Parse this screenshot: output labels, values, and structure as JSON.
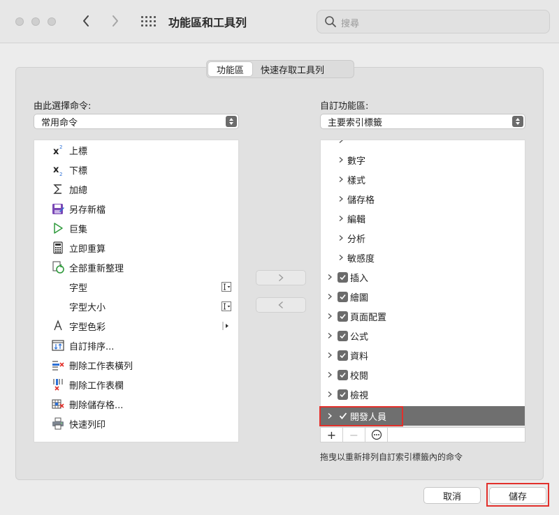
{
  "window": {
    "title": "功能區和工具列",
    "search_placeholder": "搜尋"
  },
  "tabs": [
    {
      "label": "功能區",
      "active": true
    },
    {
      "label": "快速存取工具列",
      "active": false
    }
  ],
  "left": {
    "label": "由此選擇命令:",
    "dropdown_value": "常用命令",
    "commands": [
      {
        "label": "上標",
        "icon": "superscript-icon"
      },
      {
        "label": "下標",
        "icon": "subscript-icon"
      },
      {
        "label": "加總",
        "icon": "sum-icon"
      },
      {
        "label": "另存新檔",
        "icon": "save-as-icon"
      },
      {
        "label": "巨集",
        "icon": "macro-play-icon"
      },
      {
        "label": "立即重算",
        "icon": "calculator-icon"
      },
      {
        "label": "全部重新整理",
        "icon": "refresh-all-icon"
      },
      {
        "label": "字型",
        "icon": "",
        "side": "combo-icon"
      },
      {
        "label": "字型大小",
        "icon": "",
        "side": "combo-icon"
      },
      {
        "label": "字型色彩",
        "icon": "font-color-icon",
        "side": "submenu-arrow-icon"
      },
      {
        "label": "自訂排序...",
        "icon": "custom-sort-icon"
      },
      {
        "label": "刪除工作表橫列",
        "icon": "delete-rows-icon"
      },
      {
        "label": "刪除工作表欄",
        "icon": "delete-columns-icon"
      },
      {
        "label": "刪除儲存格...",
        "icon": "delete-cells-icon"
      },
      {
        "label": "快速列印",
        "icon": "printer-icon"
      }
    ]
  },
  "right": {
    "label": "自訂功能區:",
    "dropdown_value": "主要索引標籤",
    "tree": [
      {
        "label": "數字",
        "level": 2,
        "checkbox": false
      },
      {
        "label": "樣式",
        "level": 2,
        "checkbox": false
      },
      {
        "label": "儲存格",
        "level": 2,
        "checkbox": false
      },
      {
        "label": "編輯",
        "level": 2,
        "checkbox": false
      },
      {
        "label": "分析",
        "level": 2,
        "checkbox": false
      },
      {
        "label": "敏感度",
        "level": 2,
        "checkbox": false
      },
      {
        "label": "插入",
        "level": 1,
        "checkbox": true
      },
      {
        "label": "繪圖",
        "level": 1,
        "checkbox": true
      },
      {
        "label": "頁面配置",
        "level": 1,
        "checkbox": true
      },
      {
        "label": "公式",
        "level": 1,
        "checkbox": true
      },
      {
        "label": "資料",
        "level": 1,
        "checkbox": true
      },
      {
        "label": "校閱",
        "level": 1,
        "checkbox": true
      },
      {
        "label": "檢視",
        "level": 1,
        "checkbox": true
      },
      {
        "label": "開發人員",
        "level": 1,
        "checkbox": true,
        "selected": true
      }
    ],
    "hint": "拖曳以重新排列自訂索引標籤內的命令"
  },
  "toolbar": {
    "add": "+",
    "remove": "−",
    "more": "⋯"
  },
  "buttons": {
    "cancel": "取消",
    "save": "儲存"
  },
  "colors": {
    "highlight": "#e2302b",
    "selection": "#6f6f6f"
  }
}
